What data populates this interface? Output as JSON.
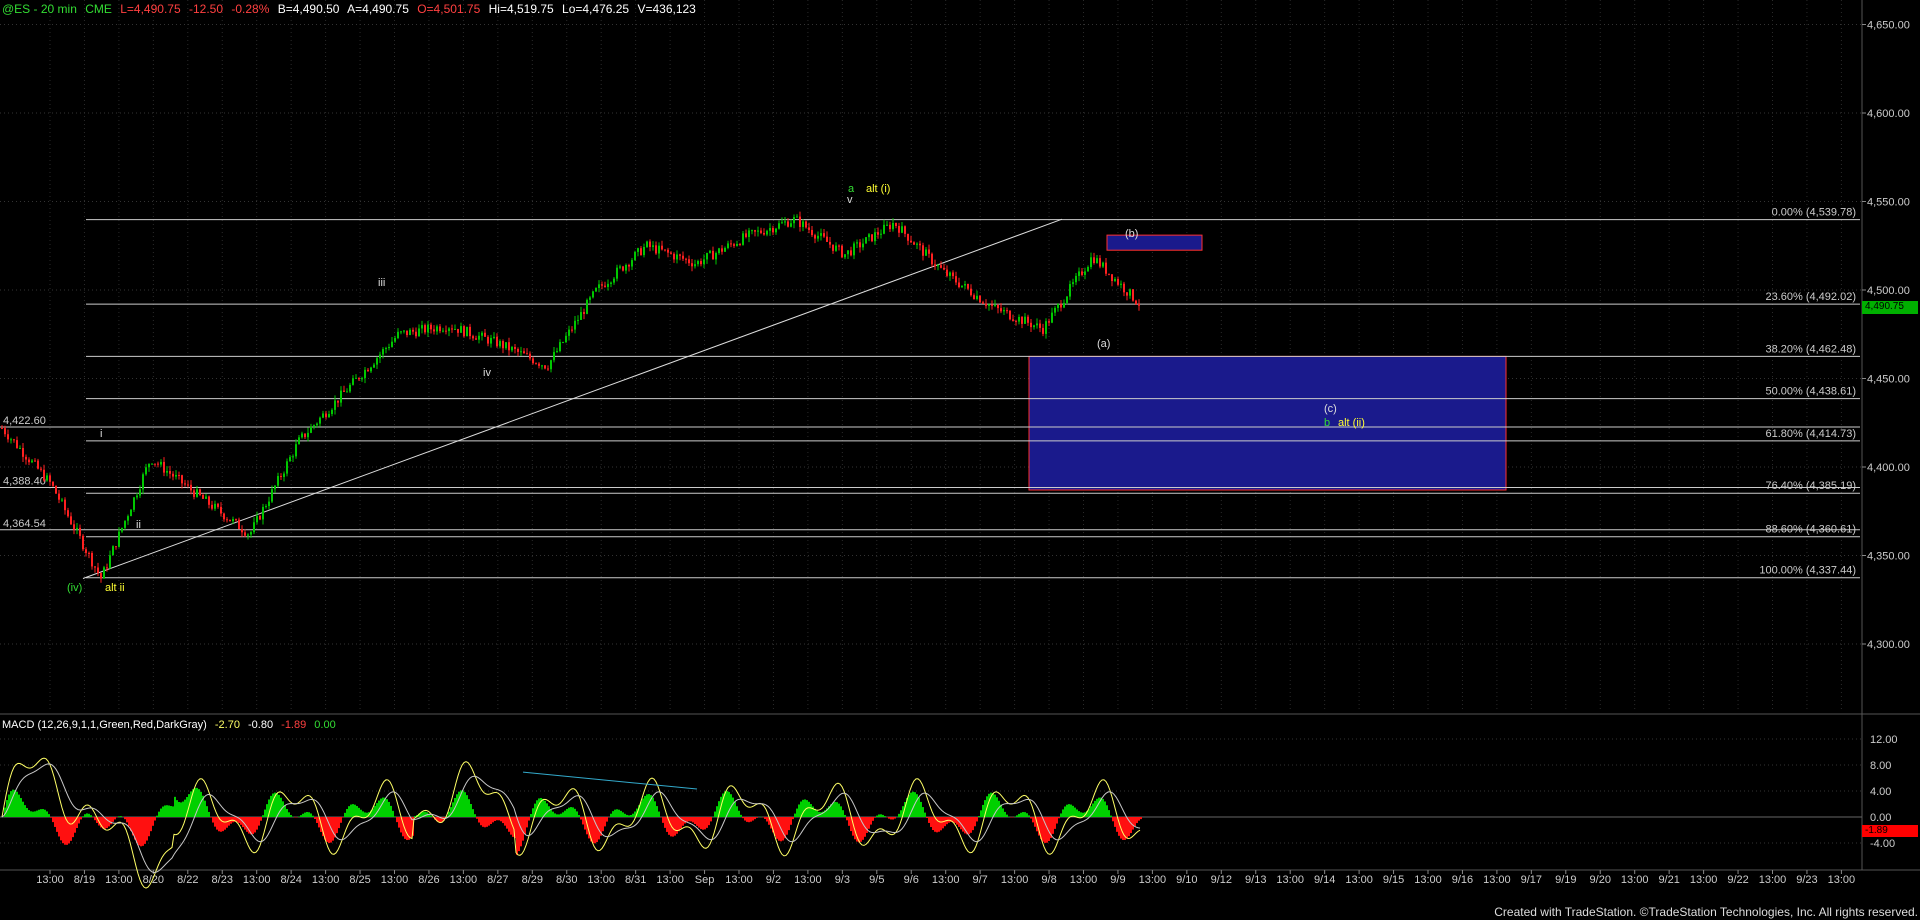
{
  "header": {
    "symbol": "@ES - 20 min",
    "exchange": "CME",
    "last": "L=4,490.75",
    "change": "-12.50",
    "change_pct": "-0.28%",
    "bid": "B=4,490.50",
    "ask": "A=4,490.75",
    "open": "O=4,501.75",
    "high": "Hi=4,519.75",
    "low": "Lo=4,476.25",
    "volume": "V=436,123"
  },
  "macd_header": {
    "label": "MACD (12,26,9,1,1,Green,Red,DarkGray)",
    "macd": "-2.70",
    "signal": "-0.80",
    "diff": "-1.89",
    "zero": "0.00"
  },
  "credit": "Created with TradeStation. ©TradeStation Technologies, Inc. All rights reserved.",
  "colors": {
    "background": "#000000",
    "candle_up": "#00c800",
    "candle_down": "#ff2020",
    "macd_line": "#ffff66",
    "signal_line": "#c8c8c8",
    "hist_pos": "#00d000",
    "hist_neg": "#ff1010",
    "target_box": "#1a1a8c",
    "target_box_border": "#ff3030",
    "fib_line": "#cccccc",
    "last_price_bg": "#00b000",
    "macd_tag_bg": "#ff0000",
    "label_green": "#33dd33",
    "label_yellow": "#ffff33",
    "label_white": "#dddddd",
    "trendline_cyan": "#33aacc"
  },
  "price_axis": {
    "ticks": [
      "4,650.00",
      "4,600.00",
      "4,550.00",
      "4,500.00",
      "4,450.00",
      "4,400.00",
      "4,350.00",
      "4,300.00"
    ],
    "last_price": "4,490.75"
  },
  "macd_axis": {
    "ticks": [
      "12.00",
      "8.00",
      "4.00",
      "0.00",
      "-4.00"
    ],
    "last_value": "-1.89"
  },
  "time_axis": [
    "13:00",
    "8/19",
    "13:00",
    "8/20",
    "8/22",
    "8/23",
    "13:00",
    "8/24",
    "13:00",
    "8/25",
    "13:00",
    "8/26",
    "13:00",
    "8/27",
    "8/29",
    "8/30",
    "13:00",
    "8/31",
    "13:00",
    "Sep",
    "13:00",
    "9/2",
    "13:00",
    "9/3",
    "9/5",
    "9/6",
    "13:00",
    "9/7",
    "13:00",
    "9/8",
    "13:00",
    "9/9",
    "13:00",
    "9/10",
    "9/12",
    "9/13",
    "13:00",
    "9/14",
    "13:00",
    "9/15",
    "13:00",
    "9/16",
    "13:00",
    "9/17",
    "9/19",
    "9/20",
    "13:00",
    "9/21",
    "13:00",
    "9/22",
    "13:00",
    "9/23",
    "13:00"
  ],
  "fib_levels": [
    {
      "label": "0.00% (4,539.78)",
      "price": 4539.78
    },
    {
      "label": "23.60% (4,492.02)",
      "price": 4492.02
    },
    {
      "label": "38.20% (4,462.48)",
      "price": 4462.48
    },
    {
      "label": "50.00% (4,438.61)",
      "price": 4438.61
    },
    {
      "label": "61.80% (4,414.73)",
      "price": 4414.73
    },
    {
      "label": "76.40% (4,385.19)",
      "price": 4385.19
    },
    {
      "label": "88.60% (4,360.61)",
      "price": 4360.61
    },
    {
      "label": "100.00% (4,337.44)",
      "price": 4337.44
    }
  ],
  "left_levels": [
    {
      "label": "4,422.60",
      "price": 4422.6
    },
    {
      "label": "4,388.40",
      "price": 4388.4
    },
    {
      "label": "4,364.54",
      "price": 4364.54
    }
  ],
  "wave_labels": {
    "iv_paren": "(iv)",
    "alt_ii": "alt ii",
    "i": "i",
    "ii": "ii",
    "iii": "iii",
    "iv": "iv",
    "a": "a",
    "alt_i": "alt (i)",
    "v": "v",
    "b_paren": "(b)",
    "a_paren": "(a)",
    "c_paren": "(c)",
    "b": "b",
    "alt_ii_paren": "alt (ii)"
  },
  "chart_data": {
    "type": "candlestick",
    "instrument": "@ES",
    "interval": "20 min",
    "ylim": [
      4255,
      4665
    ],
    "grid": true,
    "price_path": [
      {
        "x": "8/18 13:00",
        "price": 4422
      },
      {
        "x": "8/19 08:30",
        "price": 4390
      },
      {
        "x": "8/19 13:00",
        "price": 4337
      },
      {
        "x": "8/19 16:00",
        "price": 4405
      },
      {
        "x": "8/20 08:30",
        "price": 4383
      },
      {
        "x": "8/20 13:00",
        "price": 4362
      },
      {
        "x": "8/22 08:30",
        "price": 4415
      },
      {
        "x": "8/23 08:30",
        "price": 4445
      },
      {
        "x": "8/24 08:30",
        "price": 4475
      },
      {
        "x": "8/25 13:00",
        "price": 4480
      },
      {
        "x": "8/26 08:30",
        "price": 4470
      },
      {
        "x": "8/27 08:30",
        "price": 4457
      },
      {
        "x": "8/29 08:30",
        "price": 4500
      },
      {
        "x": "8/30 13:00",
        "price": 4525
      },
      {
        "x": "8/31 13:00",
        "price": 4515
      },
      {
        "x": "9/2 13:00",
        "price": 4530
      },
      {
        "x": "9/3 13:00",
        "price": 4540
      },
      {
        "x": "9/5 13:00",
        "price": 4520
      },
      {
        "x": "9/6 13:00",
        "price": 4538
      },
      {
        "x": "9/7 13:00",
        "price": 4510
      },
      {
        "x": "9/8 13:00",
        "price": 4490
      },
      {
        "x": "9/9 08:30",
        "price": 4478
      },
      {
        "x": "9/9 13:00",
        "price": 4519
      },
      {
        "x": "9/9 16:00",
        "price": 4490.75
      }
    ],
    "last": 4490.75,
    "macd": {
      "macd": -2.7,
      "signal": -0.8,
      "diff": -1.89,
      "ylim": [
        -6,
        14
      ]
    }
  }
}
